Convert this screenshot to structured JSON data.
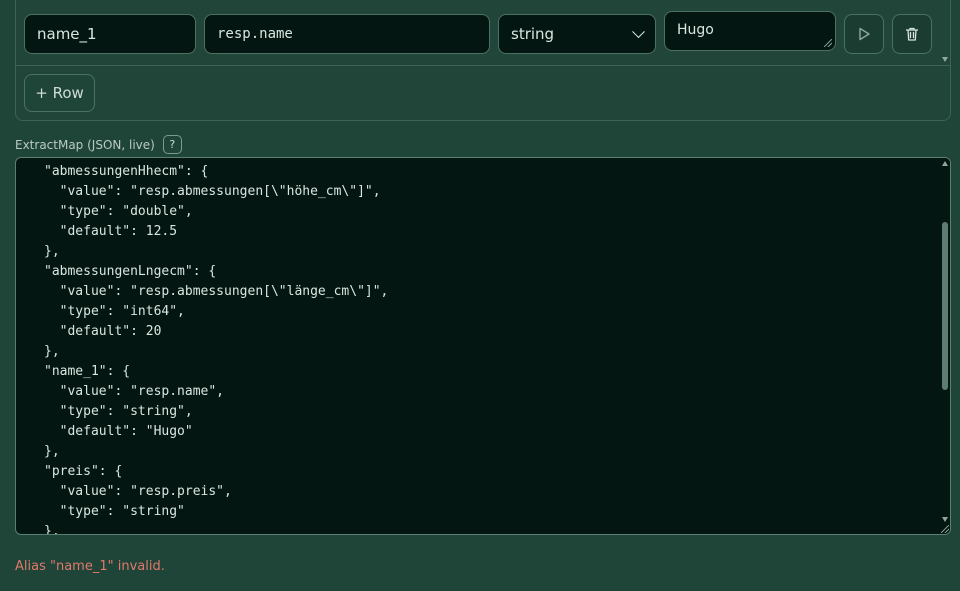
{
  "mapping_row": {
    "alias": "name_1",
    "path": "resp.name",
    "type": "string",
    "default": "Hugo"
  },
  "add_row_label": "+ Row",
  "json_section": {
    "label": "ExtractMap (JSON, live)",
    "help": "?",
    "content": "  },\n\"abmessungenHhecm\": {\n  \"value\": \"resp.abmessungen[\\\"höhe_cm\\\"]\",\n  \"type\": \"double\",\n  \"default\": 12.5\n},\n\"abmessungenLngecm\": {\n  \"value\": \"resp.abmessungen[\\\"länge_cm\\\"]\",\n  \"type\": \"int64\",\n  \"default\": 20\n},\n\"name_1\": {\n  \"value\": \"resp.name\",\n  \"type\": \"string\",\n  \"default\": \"Hugo\"\n},\n\"preis\": {\n  \"value\": \"resp.preis\",\n  \"type\": \"string\"\n},"
  },
  "error_message": "Alias \"name_1\" invalid.",
  "icons": {
    "run": "play-icon",
    "delete": "trash-icon",
    "select": "chevron-down-icon",
    "help": "help-icon"
  }
}
